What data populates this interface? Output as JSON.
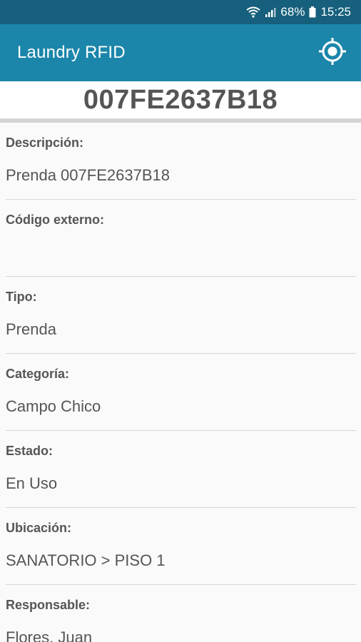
{
  "status_bar": {
    "battery": "68%",
    "time": "15:25",
    "icons": [
      "wifi-icon",
      "signal-icon",
      "battery-icon"
    ]
  },
  "app_bar": {
    "title": "Laundry RFID",
    "action_icon": "locate-icon"
  },
  "tag": {
    "code": "007FE2637B18"
  },
  "fields": [
    {
      "label": "Descripción:",
      "value": "Prenda 007FE2637B18"
    },
    {
      "label": "Código externo:",
      "value": ""
    },
    {
      "label": "Tipo:",
      "value": "Prenda"
    },
    {
      "label": "Categoría:",
      "value": "Campo Chico"
    },
    {
      "label": "Estado:",
      "value": "En Uso"
    },
    {
      "label": "Ubicación:",
      "value": "SANATORIO > PISO 1"
    },
    {
      "label": "Responsable:",
      "value": "Flores, Juan"
    }
  ],
  "colors": {
    "app_bar": "#1c86aa",
    "status_bar": "#16607d",
    "background": "#fafafa",
    "text": "#555555"
  }
}
